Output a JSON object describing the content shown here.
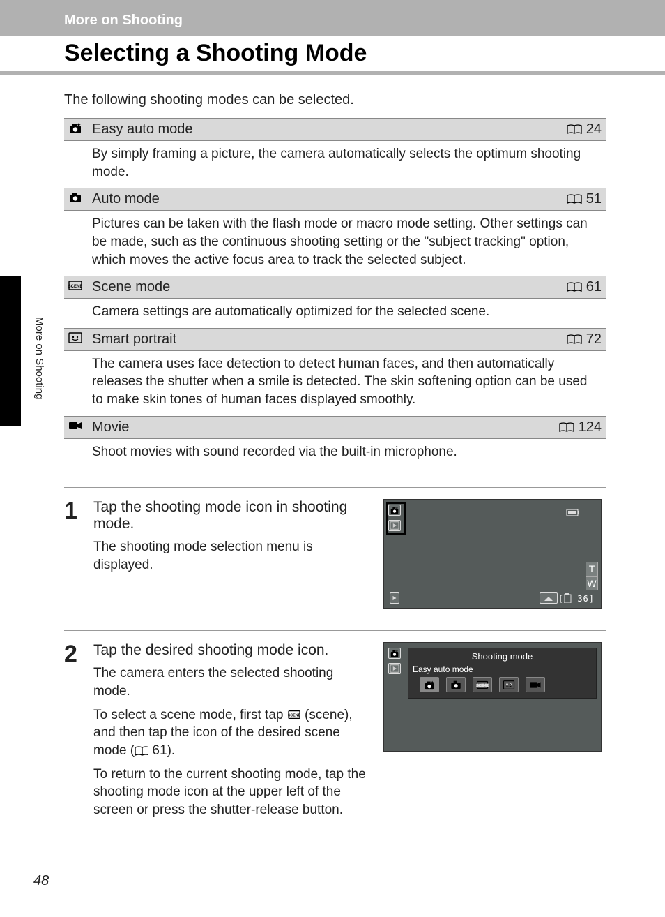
{
  "header": {
    "section": "More on Shooting",
    "title": "Selecting a Shooting Mode"
  },
  "side_tab": "More on Shooting",
  "intro": "The following shooting modes can be selected.",
  "modes": [
    {
      "icon": "easy-auto-icon",
      "name": "Easy auto mode",
      "page": "24",
      "desc": "By simply framing a picture, the camera automatically selects the optimum shooting mode."
    },
    {
      "icon": "auto-icon",
      "name": "Auto mode",
      "page": "51",
      "desc": "Pictures can be taken with the flash mode or macro mode setting. Other settings can be made, such as the continuous shooting setting or the \"subject tracking\" option, which moves the active focus area to track the selected subject."
    },
    {
      "icon": "scene-icon",
      "name": "Scene mode",
      "page": "61",
      "desc": "Camera settings are automatically optimized for the selected scene."
    },
    {
      "icon": "smart-portrait-icon",
      "name": "Smart portrait",
      "page": "72",
      "desc": "The camera uses face detection to detect human faces, and then automatically releases the shutter when a smile is detected. The skin softening option can be used to make skin tones of human faces displayed smoothly."
    },
    {
      "icon": "movie-icon",
      "name": "Movie",
      "page": "124",
      "desc": "Shoot movies with sound recorded via the built-in microphone."
    }
  ],
  "steps": [
    {
      "num": "1",
      "title": "Tap the shooting mode icon in shooting mode.",
      "paras": [
        "The shooting mode selection menu is displayed."
      ],
      "screen": "screen1"
    },
    {
      "num": "2",
      "title": "Tap the desired shooting mode icon.",
      "paras": [
        "The camera enters the selected shooting mode.",
        "To select a scene mode, first tap SCENE (scene), and then tap the icon of the desired scene mode (A 61).",
        "To return to the current shooting mode, tap the shooting mode icon at the upper left of the screen or press the shutter-release button."
      ],
      "screen": "screen2"
    }
  ],
  "screen1": {
    "zoom_t": "T",
    "zoom_w": "W",
    "mem_count": "36"
  },
  "screen2": {
    "panel_title": "Shooting mode",
    "selected_label": "Easy auto mode"
  },
  "page_number": "48",
  "scene_inline_ref_page": "61"
}
